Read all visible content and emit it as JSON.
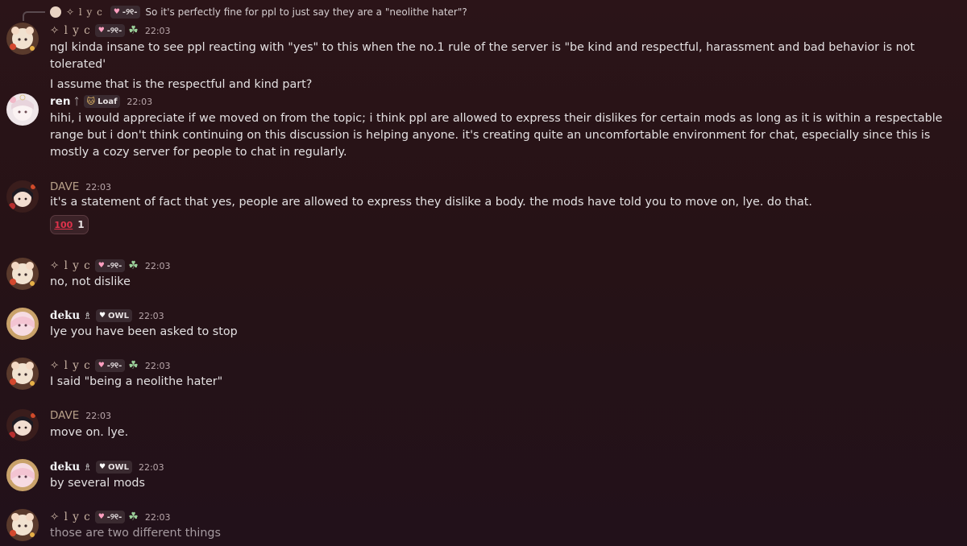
{
  "reply_preview": {
    "author": "✧ l y c",
    "tag": "-୨୧-",
    "text": "So it's perfectly fine for ppl to just say they are a \"neolithe hater\"?"
  },
  "messages": [
    {
      "author": "✧ l y c",
      "tag": "-୨୧-",
      "time": "22:03",
      "lines": [
        "ngl kinda insane to see ppl reacting with \"yes\" to this when the no.1 rule of the server is \"be kind and respectful, harassment and bad behavior is not tolerated'",
        "I assume that is the respectful and kind part?"
      ]
    },
    {
      "author": "ren",
      "glyph": "ᛏ",
      "tag": "Loaf",
      "time": "22:03",
      "text": "hihi, i would appreciate if we moved on from the topic; i think ppl are allowed to express their dislikes for certain mods as long as it is within a respectable range but i don't think continuing on this discussion is helping anyone. it's creating quite an uncomfortable environment for chat, especially since this is mostly a cozy server for people to chat in regularly."
    },
    {
      "author": "DAVE",
      "time": "22:03",
      "text": "it's a statement of fact that yes, people are allowed to express they dislike a body. the mods have told you to move on, lye. do that.",
      "reaction": {
        "emoji": "100",
        "count": "1"
      }
    },
    {
      "author": "✧ l y c",
      "tag": "-୨୧-",
      "time": "22:03",
      "text": "no, not dislike"
    },
    {
      "author": "deku",
      "glyph": "♗",
      "tag": "OWL",
      "time": "22:03",
      "text": "lye you have been asked to stop"
    },
    {
      "author": "✧ l y c",
      "tag": "-୨୧-",
      "time": "22:03",
      "text": "I said \"being a neolithe hater\""
    },
    {
      "author": "DAVE",
      "time": "22:03",
      "text": "move on. lye."
    },
    {
      "author": "deku",
      "glyph": "♗",
      "tag": "OWL",
      "time": "22:03",
      "text": "by several mods"
    },
    {
      "author": "✧ l y c",
      "tag": "-୨୧-",
      "time": "22:03",
      "text": "those are two different things"
    }
  ],
  "colors": {
    "background": "#261216",
    "reaction_red": "#e0324b",
    "lyc_name": "#c9b3a3",
    "dave_name": "#b8a089"
  }
}
